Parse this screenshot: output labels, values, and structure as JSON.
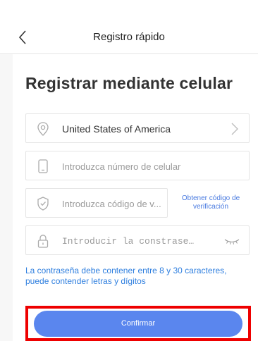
{
  "header": {
    "title": "Registro rápido",
    "back_icon": "chevron-left-icon"
  },
  "main": {
    "title": "Registrar mediante celular",
    "country": {
      "value": "United States of America",
      "icon": "location-pin-icon"
    },
    "phone": {
      "placeholder": "Introduzca número de celular",
      "icon": "phone-icon"
    },
    "code": {
      "placeholder": "Introduzca código de v...",
      "icon": "shield-check-icon",
      "get_code_label": "Obtener código de verificación"
    },
    "password": {
      "placeholder": "Introducir la constrase…",
      "icon": "lock-icon",
      "toggle_icon": "eye-closed-icon"
    },
    "hint": "La contraseña debe contener entre 8 y 30 caracteres, puede contender letras y dígitos",
    "confirm_label": "Confirmar"
  },
  "colors": {
    "accent": "#5a86ee",
    "link": "#2f7fdf",
    "highlight": "#ee0000"
  }
}
